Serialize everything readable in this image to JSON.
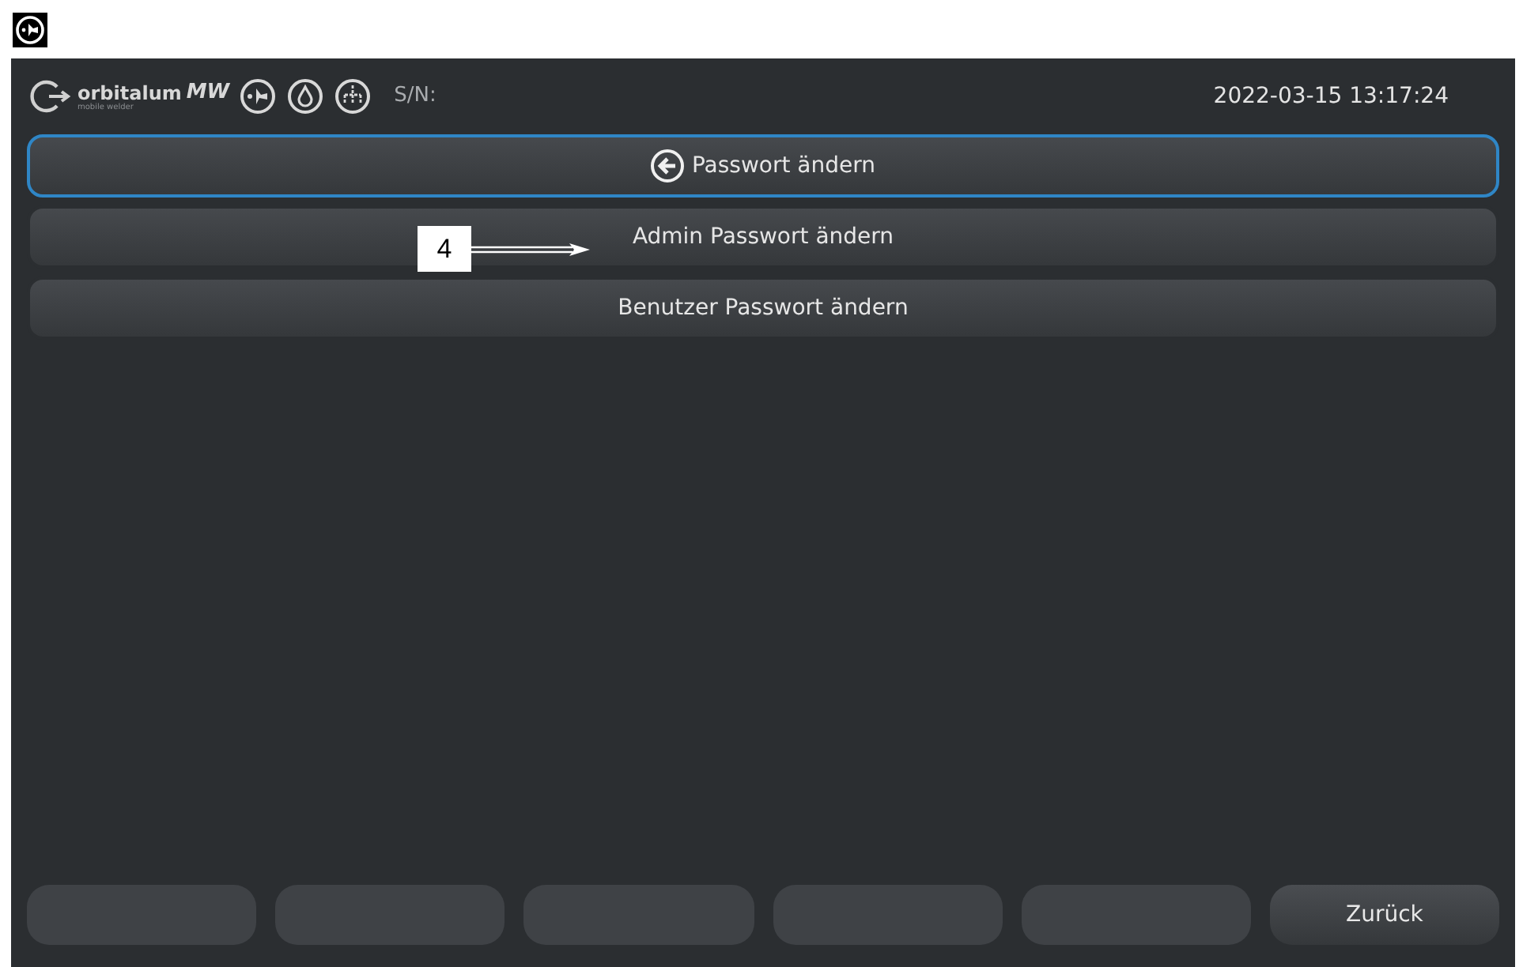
{
  "header": {
    "brand": "orbitalum",
    "brand_suffix": "MW",
    "tagline": "mobile welder",
    "serial_label": "S/N:",
    "datetime": "2022-03-15 13:17:24"
  },
  "menu": [
    {
      "kind": "back",
      "label": "Passwort ändern",
      "selected": true
    },
    {
      "kind": "item",
      "label": "Admin Passwort ändern",
      "selected": false
    },
    {
      "kind": "item",
      "label": "Benutzer Passwort ändern",
      "selected": false
    }
  ],
  "callout": {
    "label": "4"
  },
  "footer_buttons": [
    {
      "kind": "blank"
    },
    {
      "kind": "blank"
    },
    {
      "kind": "blank"
    },
    {
      "kind": "blank"
    },
    {
      "kind": "blank"
    },
    {
      "kind": "labeled",
      "label": "Zurück"
    }
  ]
}
